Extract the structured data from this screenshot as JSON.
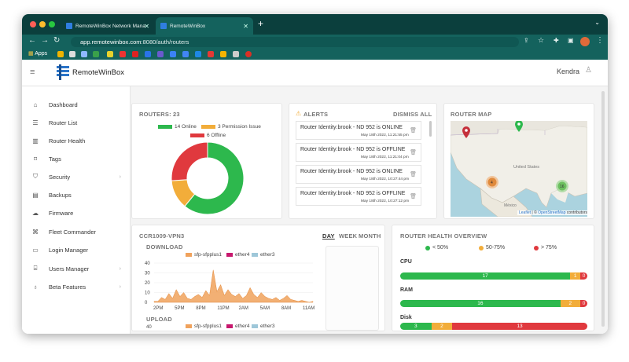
{
  "browser": {
    "tabs": [
      {
        "label": "RemoteWinBox Network Mana",
        "active": false
      },
      {
        "label": "RemoteWinBox",
        "active": true
      }
    ],
    "url_host": "app.remotewinbox.com",
    "url_path": ":8080/auth/routers",
    "bookmarks_apps": "Apps"
  },
  "app": {
    "brand": "RemoteWinBox",
    "user": "Kendra"
  },
  "sidebar": {
    "items": [
      {
        "label": "Dashboard",
        "icon": "home-icon",
        "chevron": false
      },
      {
        "label": "Router List",
        "icon": "list-icon",
        "chevron": false
      },
      {
        "label": "Router Health",
        "icon": "bar-chart-icon",
        "chevron": false
      },
      {
        "label": "Tags",
        "icon": "tag-icon",
        "chevron": false
      },
      {
        "label": "Security",
        "icon": "shield-icon",
        "chevron": true
      },
      {
        "label": "Backups",
        "icon": "archive-icon",
        "chevron": false
      },
      {
        "label": "Firmware",
        "icon": "cloud-icon",
        "chevron": false
      },
      {
        "label": "Fleet Commander",
        "icon": "command-icon",
        "chevron": false
      },
      {
        "label": "Login Manager",
        "icon": "id-card-icon",
        "chevron": false
      },
      {
        "label": "Users Manager",
        "icon": "users-icon",
        "chevron": true
      },
      {
        "label": "Beta Features",
        "icon": "lightbulb-icon",
        "chevron": true
      }
    ]
  },
  "routers": {
    "title": "ROUTERS: 23",
    "legend": [
      {
        "label": "14 Online",
        "color": "#2db84d"
      },
      {
        "label": "3 Permission Issue",
        "color": "#f2ad3a"
      },
      {
        "label": "6 Offline",
        "color": "#e0393e"
      }
    ]
  },
  "alerts": {
    "title": "ALERTS",
    "dismiss": "DISMISS ALL",
    "items": [
      {
        "text": "Router Identity:brook - ND 952 is ONLINE",
        "date": "May 18th 2022, 11:21:55 pm"
      },
      {
        "text": "Router Identity:brook - ND 952 is OFFLINE",
        "date": "May 18th 2022, 11:21:04 pm"
      },
      {
        "text": "Router Identity:brook - ND 952 is ONLINE",
        "date": "May 18th 2022, 10:27:44 pm"
      },
      {
        "text": "Router Identity:brook - ND 952 is OFFLINE",
        "date": "May 18th 2022, 10:27:12 pm"
      }
    ]
  },
  "map": {
    "title": "ROUTER MAP",
    "country": "United States",
    "mexico": "México",
    "clusters": [
      "4",
      "16"
    ],
    "attribution_leaflet": "Leaflet",
    "attribution_sep": " | © ",
    "attribution_osm": "OpenStreetMap",
    "attribution_tail": " contributors"
  },
  "traffic": {
    "router": "CCR1009-VPN3",
    "ranges": [
      "DAY",
      "WEEK",
      "MONTH"
    ],
    "download_label": "DOWNLOAD",
    "upload_label": "UPLOAD",
    "legend": [
      {
        "label": "sfp-sfpplus1",
        "color": "#f0a25c"
      },
      {
        "label": "ether4",
        "color": "#c7186e"
      },
      {
        "label": "ether3",
        "color": "#9ec7d9"
      }
    ],
    "yticks": [
      "40",
      "30",
      "20",
      "10",
      "0"
    ],
    "upload_ytick": "40",
    "xticks": [
      "2PM",
      "5PM",
      "8PM",
      "11PM",
      "2AM",
      "5AM",
      "8AM",
      "11AM"
    ]
  },
  "chart_data": {
    "type": "area",
    "title": "DOWNLOAD",
    "x": [
      "2PM",
      "5PM",
      "8PM",
      "11PM",
      "2AM",
      "5AM",
      "8AM",
      "11AM"
    ],
    "ylim": [
      0,
      40
    ],
    "series": [
      {
        "name": "sfp-sfpplus1",
        "values": [
          1,
          1,
          5,
          3,
          9,
          4,
          13,
          6,
          10,
          4,
          3,
          6,
          8,
          5,
          12,
          7,
          33,
          11,
          18,
          7,
          13,
          8,
          6,
          9,
          4,
          7,
          15,
          8,
          5,
          10,
          6,
          4,
          3,
          5,
          2,
          4,
          7,
          3,
          2,
          1,
          2,
          1,
          0,
          1
        ]
      },
      {
        "name": "ether4",
        "values": [
          0
        ]
      },
      {
        "name": "ether3",
        "values": [
          0
        ]
      }
    ]
  },
  "health": {
    "title": "ROUTER HEALTH OVERVIEW",
    "legend": [
      {
        "label": "< 50%",
        "color": "#2db84d"
      },
      {
        "label": "50-75%",
        "color": "#f2ad3a"
      },
      {
        "label": "> 75%",
        "color": "#e0393e"
      }
    ],
    "rows": [
      {
        "label": "CPU",
        "segments": [
          {
            "value": "17",
            "color": "#2db84d",
            "flex": 17
          },
          {
            "value": "1",
            "color": "#f2ad3a",
            "flex": 1
          },
          {
            "value": "0",
            "color": "#e0393e",
            "flex": 0.7
          }
        ]
      },
      {
        "label": "RAM",
        "segments": [
          {
            "value": "16",
            "color": "#2db84d",
            "flex": 16
          },
          {
            "value": "2",
            "color": "#f2ad3a",
            "flex": 2
          },
          {
            "value": "0",
            "color": "#e0393e",
            "flex": 0.7
          }
        ]
      },
      {
        "label": "Disk",
        "segments": [
          {
            "value": "3",
            "color": "#2db84d",
            "flex": 3
          },
          {
            "value": "2",
            "color": "#f2ad3a",
            "flex": 2
          },
          {
            "value": "13",
            "color": "#e0393e",
            "flex": 13
          }
        ]
      }
    ]
  }
}
